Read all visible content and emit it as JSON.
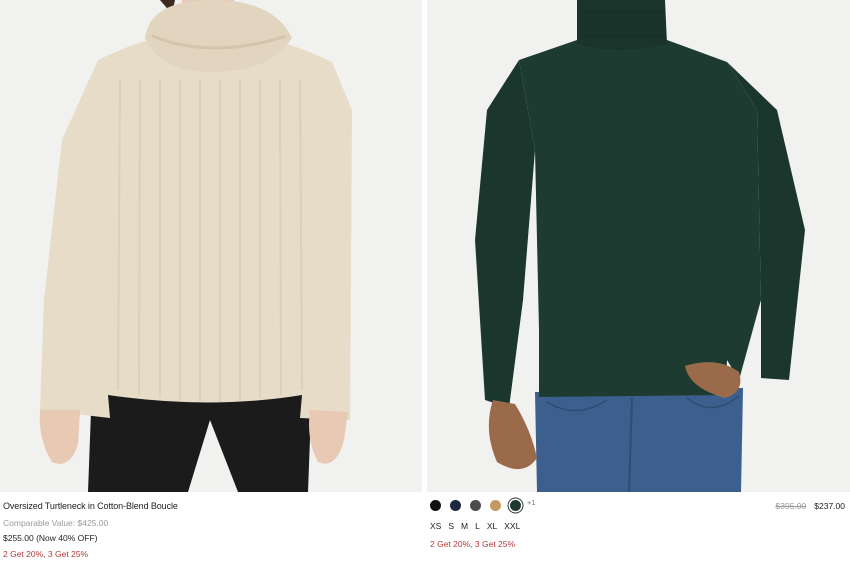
{
  "products": [
    {
      "title": "Oversized Turtleneck in Cotton-Blend Boucle",
      "comparable_value": "Comparable Value: $425.00",
      "price": "$255.00 (Now 40% OFF)",
      "promo": "2 Get 20%, 3 Get 25%",
      "image_icon": "beige-turtleneck-sweater-photo"
    },
    {
      "swatches": [
        {
          "color": "#111111",
          "selected": false
        },
        {
          "color": "#1c2740",
          "selected": false
        },
        {
          "color": "#4b4b4b",
          "selected": false
        },
        {
          "color": "#c49a62",
          "selected": false
        },
        {
          "color": "#1e3a30",
          "selected": true
        }
      ],
      "swatch_more": "+1",
      "old_price": "$395.00",
      "new_price": "$237.00",
      "sizes": [
        "XS",
        "S",
        "M",
        "L",
        "XL",
        "XXL"
      ],
      "promo": "2 Get 20%, 3 Get 25%",
      "image_icon": "green-turtleneck-sweater-photo"
    }
  ]
}
